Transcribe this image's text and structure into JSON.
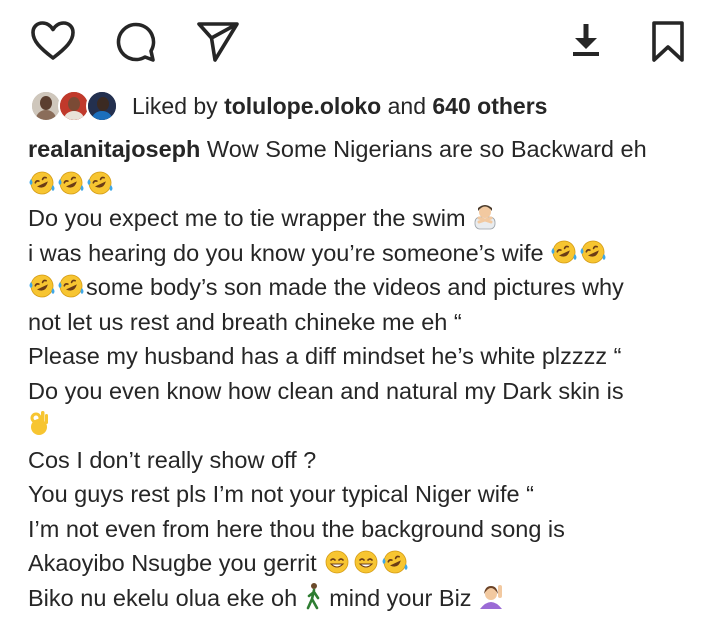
{
  "actions": {
    "like_icon": "heart-icon",
    "comment_icon": "comment-icon",
    "share_icon": "send-icon",
    "download_icon": "download-icon",
    "save_icon": "bookmark-icon"
  },
  "likes": {
    "prefix": "Liked by ",
    "user": "tolulope.oloko",
    "middle": " and ",
    "others": "640 others"
  },
  "caption": {
    "username": "realanitajoseph",
    "l1": " Wow Some Nigerians are so Backward eh",
    "l3": "Do you expect me to tie wrapper the swim ",
    "l4": " i was hearing do you know you’re someone’s wife ",
    "l5": "some body’s son made the videos and pictures why",
    "l6": "not let us rest and breath chineke me eh “",
    "l7": "Please my husband has a diff mindset he’s white plzzzz “",
    "l8": "Do you even know how clean and natural my Dark skin is",
    "l10": "Cos I don’t really show off ?",
    "l11": "You guys rest pls I’m not your typical Niger wife “",
    "l12": "I’m not even from here thou the background song is",
    "l13": "Akaoyibo Nsugbe you gerrit ",
    "l14a": "Biko nu ekelu olua eke oh ",
    "l14b": " mind your Biz "
  },
  "colors": {
    "text": "#262626",
    "emoji_yellow": "#F7C531",
    "emoji_tear": "#3FA8E8",
    "emoji_mouth": "#6B3C16"
  }
}
